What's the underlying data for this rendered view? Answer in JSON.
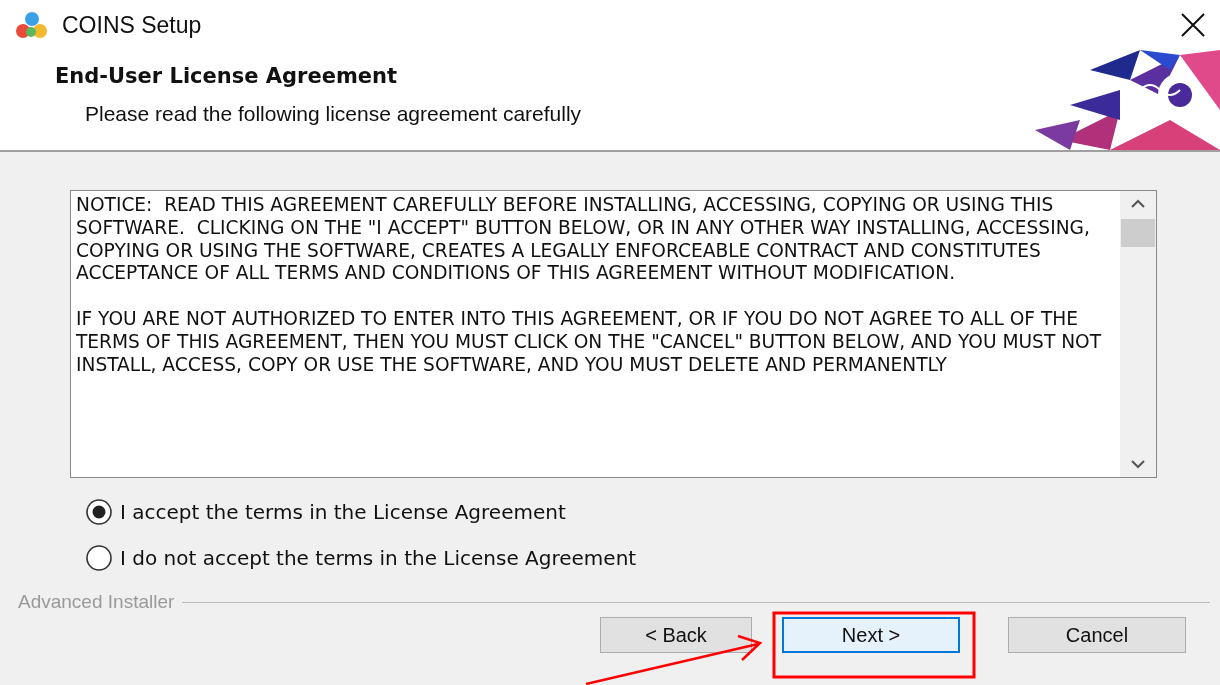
{
  "window": {
    "title": "COINS Setup"
  },
  "header": {
    "title": "End-User License Agreement",
    "subtitle": "Please read the following license agreement carefully"
  },
  "license": {
    "paragraphs": [
      "NOTICE:  READ THIS AGREEMENT CAREFULLY BEFORE INSTALLING, ACCESSING, COPYING OR USING THIS SOFTWARE.  CLICKING ON THE \"I ACCEPT\" BUTTON BELOW, OR IN ANY OTHER WAY INSTALLING, ACCESSING, COPYING OR USING THE SOFTWARE, CREATES A LEGALLY ENFORCEABLE CONTRACT AND CONSTITUTES ACCEPTANCE OF ALL TERMS AND CONDITIONS OF THIS AGREEMENT WITHOUT MODIFICATION.",
      "IF YOU ARE NOT AUTHORIZED TO ENTER INTO THIS AGREEMENT, OR IF YOU DO NOT AGREE TO ALL OF THE TERMS OF THIS AGREEMENT, THEN YOU MUST CLICK ON THE \"CANCEL\" BUTTON BELOW, AND YOU MUST NOT INSTALL, ACCESS, COPY OR USE THE SOFTWARE, AND YOU MUST DELETE AND PERMANENTLY"
    ]
  },
  "options": [
    {
      "label": "I accept the terms in the License Agreement",
      "selected": true
    },
    {
      "label": "I do not accept the terms in the License Agreement",
      "selected": false
    }
  ],
  "footer": {
    "brand": "Advanced Installer"
  },
  "buttons": [
    {
      "label": "< Back",
      "default": false
    },
    {
      "label": "Next >",
      "default": true
    },
    {
      "label": "Cancel",
      "default": false
    }
  ],
  "annotations": {
    "highlight_frame": true,
    "arrow": true
  }
}
